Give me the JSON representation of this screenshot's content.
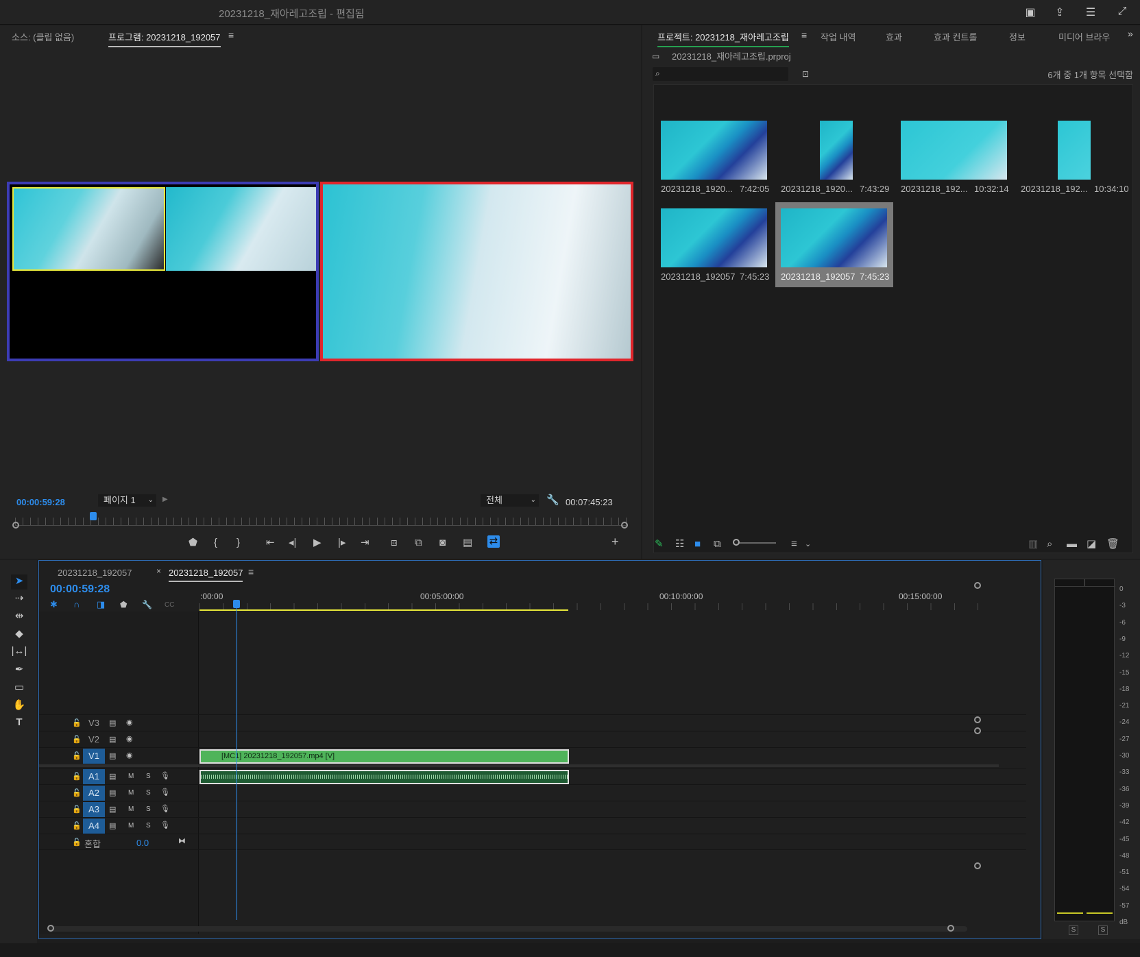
{
  "window": {
    "title": "20231218_재아레고조립 - 편집됨"
  },
  "source_monitor": {
    "tab_source": "소스: (클립 없음)",
    "tab_program": "프로그램: 20231218_192057",
    "timecode": "00:00:59:28",
    "page_select": "페이지 1",
    "fit_select": "전체",
    "duration": "00:07:45:23",
    "playhead_fraction": 0.128
  },
  "project": {
    "tabs": [
      "프로젝트: 20231218_재아레고조립",
      "작업 내역",
      "효과",
      "효과 컨트롤",
      "정보",
      "미디어 브라우"
    ],
    "file": "20231218_재아레고조립.prproj",
    "search_placeholder": "",
    "selection_status": "6개 중 1개 항목 선택함",
    "items": [
      {
        "name": "20231218_1920...",
        "duration": "7:42:05"
      },
      {
        "name": "20231218_1920...",
        "duration": "7:43:29"
      },
      {
        "name": "20231218_192...",
        "duration": "10:32:14"
      },
      {
        "name": "20231218_192...",
        "duration": "10:34:10"
      },
      {
        "name": "20231218_192057",
        "duration": "7:45:23"
      },
      {
        "name": "20231218_192057",
        "duration": "7:45:23"
      }
    ]
  },
  "timeline": {
    "tab_1": "20231218_192057",
    "tab_2": "20231218_192057",
    "timecode": "00:00:59:28",
    "ruler": [
      ":00:00",
      "00:05:00:00",
      "00:10:00:00",
      "00:15:00:00"
    ],
    "video_tracks": [
      "V3",
      "V2",
      "V1"
    ],
    "audio_tracks": [
      "A1",
      "A2",
      "A3",
      "A4"
    ],
    "mute_label": "M",
    "solo_label": "S",
    "mix_label": "혼합",
    "mix_value": "0.0",
    "clip_label": "[MC1] 20231218_192057.mp4 [V]"
  },
  "meter": {
    "scale": [
      "0",
      "-3",
      "-6",
      "-9",
      "-12",
      "-15",
      "-18",
      "-21",
      "-24",
      "-27",
      "-30",
      "-33",
      "-36",
      "-39",
      "-42",
      "-45",
      "-48",
      "-51",
      "-54",
      "-57",
      "dB"
    ],
    "solo_left": "S",
    "solo_right": "S"
  },
  "colors": {
    "accent": "#2d8ceb",
    "clip_video": "#4fb45a",
    "clip_audio": "#1f5b33",
    "cam_blue": "#3c3cb4",
    "cam_red": "#e0262c",
    "cam_yellow": "#e8e83a"
  }
}
